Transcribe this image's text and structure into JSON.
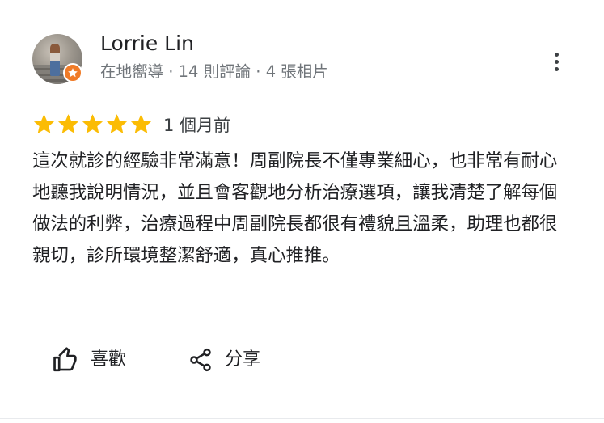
{
  "reviewer": {
    "name": "Lorrie Lin",
    "meta": "在地嚮導 · 14 則評論 · 4 張相片",
    "avatar_icon": "user-photo-avatar",
    "badge_icon": "local-guide-badge-icon",
    "badge_color": "#f07b27"
  },
  "review": {
    "rating": 5,
    "rating_max": 5,
    "star_color": "#fbbc04",
    "date": "1 個月前",
    "text": "這次就診的經驗非常滿意！周副院長不僅專業細心，也非常有耐心地聽我說明情況，並且會客觀地分析治療選項，讓我清楚了解每個做法的利弊，治療過程中周副院長都很有禮貌且溫柔，助理也都很親切，診所環境整潔舒適，真心推推。"
  },
  "actions": {
    "like_label": "喜歡",
    "like_icon": "thumb-up-icon",
    "share_label": "分享",
    "share_icon": "share-icon",
    "more_icon": "more-vert-icon"
  }
}
